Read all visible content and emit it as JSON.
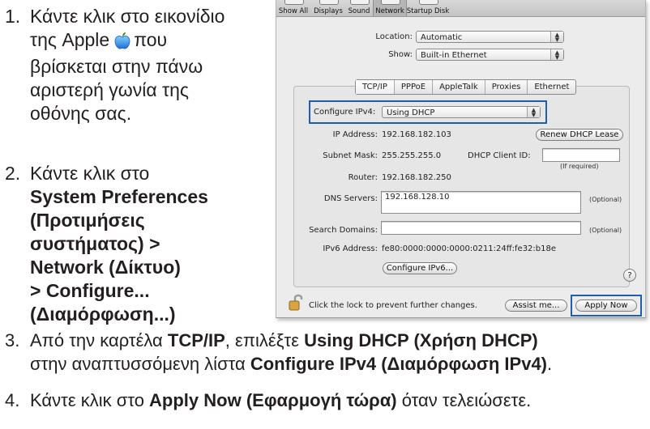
{
  "steps": [
    {
      "number": "1.",
      "lines": [
        "Κάντε κλικ στο εικονίδιο",
        "της Apple",
        "που",
        "βρίσκεται στην πάνω",
        "αριστερή γωνία της",
        "οθόνης σας."
      ]
    },
    {
      "number": "2.",
      "lines": [
        "Κάντε κλικ στο",
        "System Preferences",
        "(Προτιμήσεις",
        "συστήματος) >",
        "Network (Δίκτυο)",
        "> Configure...",
        "(Διαμόρφωση...)"
      ]
    },
    {
      "number": "3.",
      "line1": [
        "Από την καρτέλα ",
        "TCP/IP",
        ", επιλέξτε ",
        "Using DHCP (Χρήση DHCP)"
      ],
      "line2": [
        "στην αναπτυσσόμενη λίστα ",
        "Configure IPv4 (Διαμόρφωση IPv4)",
        "."
      ]
    },
    {
      "number": "4.",
      "parts": [
        "Κάντε κλικ στο ",
        "Apply Now (Εφαρμογή τώρα)",
        " όταν τελειώσετε."
      ]
    }
  ],
  "screenshot": {
    "toolbar": [
      "Show All",
      "Displays",
      "Sound",
      "Network",
      "Startup Disk"
    ],
    "location_label": "Location:",
    "location_value": "Automatic",
    "show_label": "Show:",
    "show_value": "Built-in Ethernet",
    "tabs": [
      "TCP/IP",
      "PPPoE",
      "AppleTalk",
      "Proxies",
      "Ethernet"
    ],
    "configure_label": "Configure IPv4:",
    "configure_value": "Using DHCP",
    "ip_label": "IP Address:",
    "ip_value": "192.168.182.103",
    "renew_button": "Renew DHCP Lease",
    "subnet_label": "Subnet Mask:",
    "subnet_value": "255.255.255.0",
    "client_id_label": "DHCP Client ID:",
    "if_required": "(If required)",
    "router_label": "Router:",
    "router_value": "192.168.182.250",
    "dns_label": "DNS Servers:",
    "dns_value": "192.168.128.10",
    "optional": "(Optional)",
    "search_label": "Search Domains:",
    "ipv6_label": "IPv6 Address:",
    "ipv6_value": "fe80:0000:0000:0000:0211:24ff:fe32:b18e",
    "configure_ipv6_button": "Configure IPv6...",
    "help": "?",
    "lock_text": "Click the lock to prevent further changes.",
    "assist_button": "Assist me...",
    "apply_button": "Apply Now",
    "highlight_color": "#1f5ea8"
  }
}
